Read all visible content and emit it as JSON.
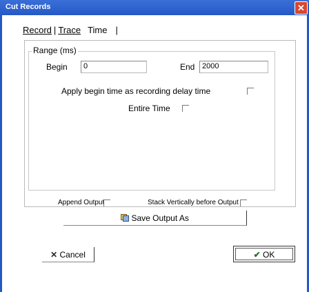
{
  "window": {
    "title": "Cut Records",
    "close_glyph": "✕"
  },
  "tabs": [
    {
      "label": "Record"
    },
    {
      "label": "Trace"
    },
    {
      "label": "Time"
    }
  ],
  "range": {
    "legend": "Range (ms)",
    "begin_label": "Begin",
    "begin_value": "0",
    "end_label": "End",
    "end_value": "2000",
    "apply_label": "Apply begin time as recording delay time",
    "entire_label": "Entire Time"
  },
  "options": {
    "append_output": "Append Output",
    "stack_vertically": "Stack Vertically before Output"
  },
  "buttons": {
    "save_output": "Save Output As",
    "cancel": "Cancel",
    "ok": "OK"
  },
  "icons": {
    "save": "save-disk-icon",
    "cancel": "x-icon",
    "ok": "check-icon"
  }
}
